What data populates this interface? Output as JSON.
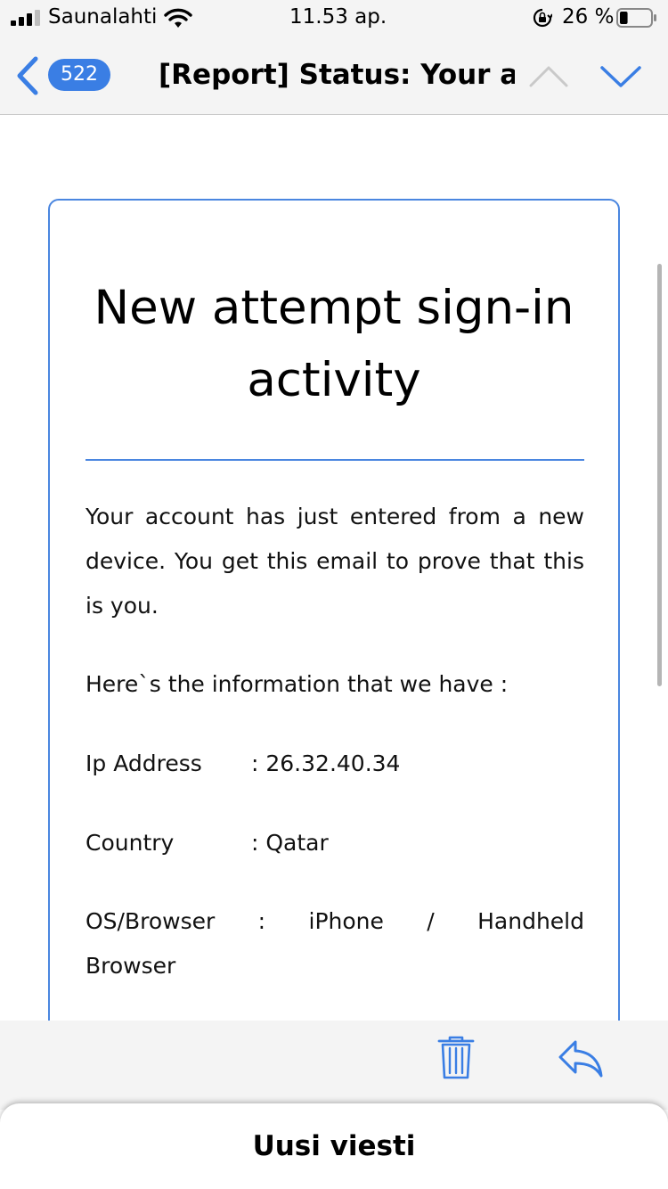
{
  "status_bar": {
    "carrier": "Saunalahti",
    "time": "11.53 ap.",
    "battery_percent": "26 %",
    "battery_level": 0.26,
    "icons": [
      "signal-icon",
      "wifi-icon",
      "orientation-lock-icon",
      "battery-icon"
    ]
  },
  "nav": {
    "back_count": "522",
    "title": "[Report] Status: Your a...",
    "icons": [
      "back-chevron-icon",
      "chevron-up-icon",
      "chevron-down-icon"
    ]
  },
  "email": {
    "heading": "New attempt sign-in activity",
    "paragraph": "Your account has just entered from a new device. You get this email to prove that this is you.",
    "info_intro": "Here`s the information that we have :",
    "ip_label": "Ip Address",
    "ip_value": ": 26.32.40.34",
    "country_label": "Country",
    "country_value": ": Qatar",
    "os_label": "OS/Browser",
    "os_sep": ":",
    "os_device": "iPhone",
    "os_slash": "/",
    "os_browser_1": "Handheld",
    "os_browser_2": "Browser"
  },
  "toolbar": {
    "icons": [
      "trash-icon",
      "reply-icon"
    ]
  },
  "sheet": {
    "title": "Uusi viesti"
  },
  "colors": {
    "accent": "#3a7ee4",
    "card_border": "#4a86e0",
    "bar_bg": "#f4f4f4"
  }
}
